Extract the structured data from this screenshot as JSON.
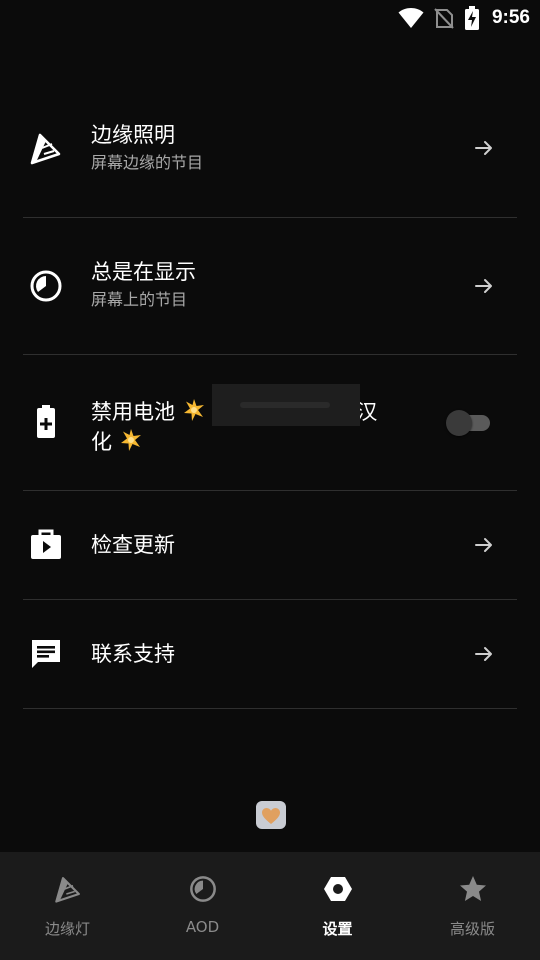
{
  "status_bar": {
    "time": "9:56",
    "icons": [
      "wifi-icon",
      "no-sim-icon",
      "battery-charging-icon"
    ]
  },
  "settings": {
    "items": [
      {
        "title": "边缘照明",
        "subtitle": "屏幕边缘的节目",
        "icon": "edge-lighting-icon",
        "action": "arrow"
      },
      {
        "title": "总是在显示",
        "subtitle": "屏幕上的节目",
        "icon": "aod-clock-icon",
        "action": "arrow"
      },
      {
        "title_line1_a": "禁用电池",
        "title_line1_b": "汉",
        "title_line2": "化",
        "icon": "battery-plus-icon",
        "action": "toggle",
        "toggle_on": false
      },
      {
        "title": "检查更新",
        "icon": "store-play-icon",
        "action": "arrow"
      },
      {
        "title": "联系支持",
        "icon": "chat-icon",
        "action": "arrow"
      }
    ]
  },
  "colors": {
    "background": "#0b0b0b",
    "nav_background": "#1b1b1b",
    "divider": "#2f2f2f",
    "secondary_text": "#a8a8a8",
    "inactive_nav": "#8a8a8a",
    "heart": "#e0a060"
  },
  "bottom_nav": {
    "items": [
      {
        "label": "边缘灯",
        "icon": "edge-lighting-icon",
        "active": false
      },
      {
        "label": "AOD",
        "icon": "aod-clock-icon",
        "active": false
      },
      {
        "label": "设置",
        "icon": "settings-gear-icon",
        "active": true
      },
      {
        "label": "高级版",
        "icon": "star-icon",
        "active": false
      }
    ]
  }
}
